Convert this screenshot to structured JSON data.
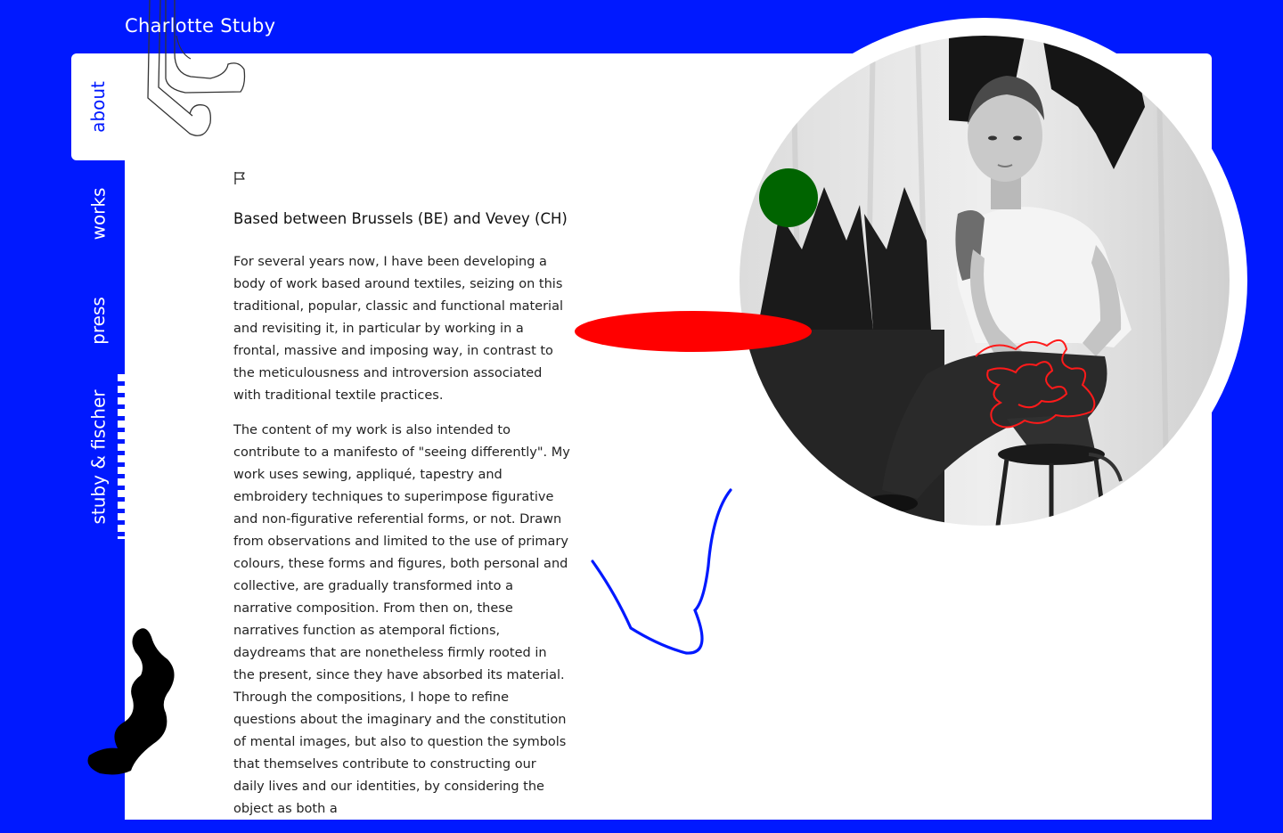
{
  "site": {
    "title": "Charlotte Stuby"
  },
  "nav": {
    "items": [
      {
        "label": "about",
        "active": true
      },
      {
        "label": "works",
        "active": false
      },
      {
        "label": "press",
        "active": false
      },
      {
        "label": "stuby & fischer",
        "active": false
      }
    ]
  },
  "about": {
    "location": "Based between Brussels (BE) and Vevey (CH)",
    "paragraphs": [
      "For several years now, I have been developing a body of work based around textiles, seizing on this traditional, popular, classic and functional material and revisiting it, in particular by working in a frontal, massive and imposing way, in contrast to the meticulousness and introversion associated with traditional textile practices.",
      "The content of my work is also intended to contribute to a manifesto of \"seeing differently\". My work uses sewing, appliqué, tapestry and embroidery techniques to superimpose figurative and non-figurative referential forms, or not. Drawn from observations and limited to the use of primary colours, these forms and figures, both personal and collective, are gradually transformed into a narrative composition. From then on, these narratives function as atemporal fictions, daydreams that are nonetheless firmly rooted in the present, since they have absorbed its material. Through the compositions, I hope to refine questions about the imaginary and the constitution of mental images, but also to question the symbols that themselves contribute to constructing our daily lives and our identities, by considering the object as both a"
    ]
  },
  "colors": {
    "background": "#0019ff",
    "panel": "#ffffff",
    "accent_red": "#ff0000",
    "accent_green": "#006400",
    "accent_blue": "#0019ff"
  },
  "icons": {
    "flag": "flag-icon",
    "line_sketch": "line-sketch-decoration",
    "black_squiggle": "black-squiggle-decoration",
    "blue_line": "blue-line-decoration",
    "red_scribble": "red-scribble-decoration",
    "green_dot": "green-dot-decoration",
    "red_ellipse": "red-ellipse-decoration"
  }
}
